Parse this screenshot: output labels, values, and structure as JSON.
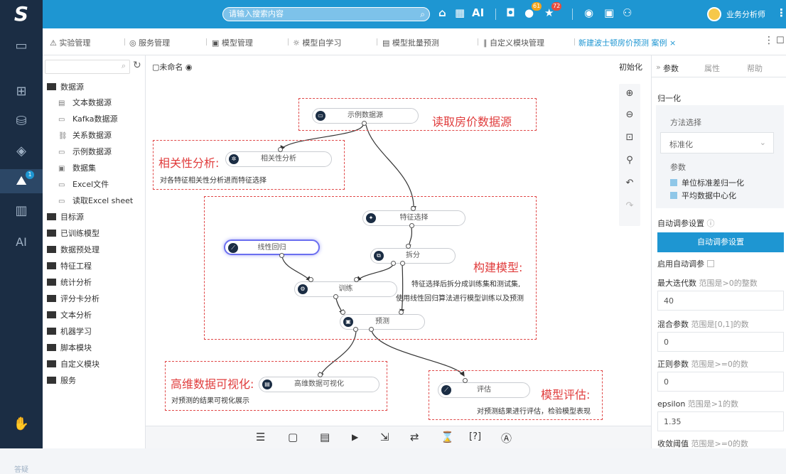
{
  "header": {
    "logo": "S",
    "search_placeholder": "请输入搜索内容",
    "ai_label": "AI",
    "badges": [
      "61",
      "72"
    ],
    "user_name": "业务分析师"
  },
  "sidebar": {
    "badge": "1",
    "ai_label": "AI",
    "help_label": "答疑"
  },
  "tabs": [
    "实验管理",
    "服务管理",
    "模型管理",
    "模型自学习",
    "模型批量预测",
    "自定义模块管理",
    "新建波士顿房价预测 案例"
  ],
  "tab_close": "×",
  "left_tree": {
    "items": [
      "数据源",
      "文本数据源",
      "Kafka数据源",
      "关系数据源",
      "示例数据源",
      "数据集",
      "Excel文件",
      "读取Excel sheet",
      "目标源",
      "已训练模型",
      "数据预处理",
      "特征工程",
      "统计分析",
      "评分卡分析",
      "文本分析",
      "机器学习",
      "脚本模块",
      "自定义模块",
      "服务"
    ]
  },
  "canvas": {
    "title": "未命名",
    "init_label": "初始化",
    "nodes": [
      "示例数据源",
      "相关性分析",
      "特征选择",
      "线性回归",
      "拆分",
      "训练",
      "预测",
      "高维数据可视化",
      "评估"
    ],
    "annotations": {
      "read": "读取房价数据源",
      "corr": "相关性分析:",
      "corr_note": "对各特征相关性分析进而特征选择",
      "build": "构建模型:",
      "build_note1": "特征选择后拆分成训练集和测试集,",
      "build_note2": "使用线性回归算法进行模型训练以及预测",
      "vis": "高维数据可视化:",
      "vis_note": "对预测的结果可视化展示",
      "eval": "模型评估:",
      "eval_note": "对预测结果进行评估，检验模型表现"
    }
  },
  "bottombar": {
    "help": "[?]"
  },
  "right_panel": {
    "tabs": [
      "参数",
      "属性",
      "帮助"
    ],
    "section": "归一化",
    "method_label": "方法选择",
    "method_value": "标准化",
    "params_label": "参数",
    "checks": [
      "单位标准差归一化",
      "平均数据中心化"
    ],
    "auto_tune_label": "自动调参设置",
    "auto_tune_button": "自动调参设置",
    "enable_auto": "启用自动调参",
    "fields": [
      {
        "label": "最大迭代数",
        "hint": "范围是>0的整数",
        "value": "40"
      },
      {
        "label": "混合参数",
        "hint": "范围是[0,1]的数",
        "value": "0"
      },
      {
        "label": "正则参数",
        "hint": "范围是>=0的数",
        "value": "0"
      },
      {
        "label": "epsilon",
        "hint": "范围是>1的数",
        "value": "1.35"
      },
      {
        "label": "收敛阈值",
        "hint": "范围是>=0的数",
        "value": ""
      }
    ]
  }
}
